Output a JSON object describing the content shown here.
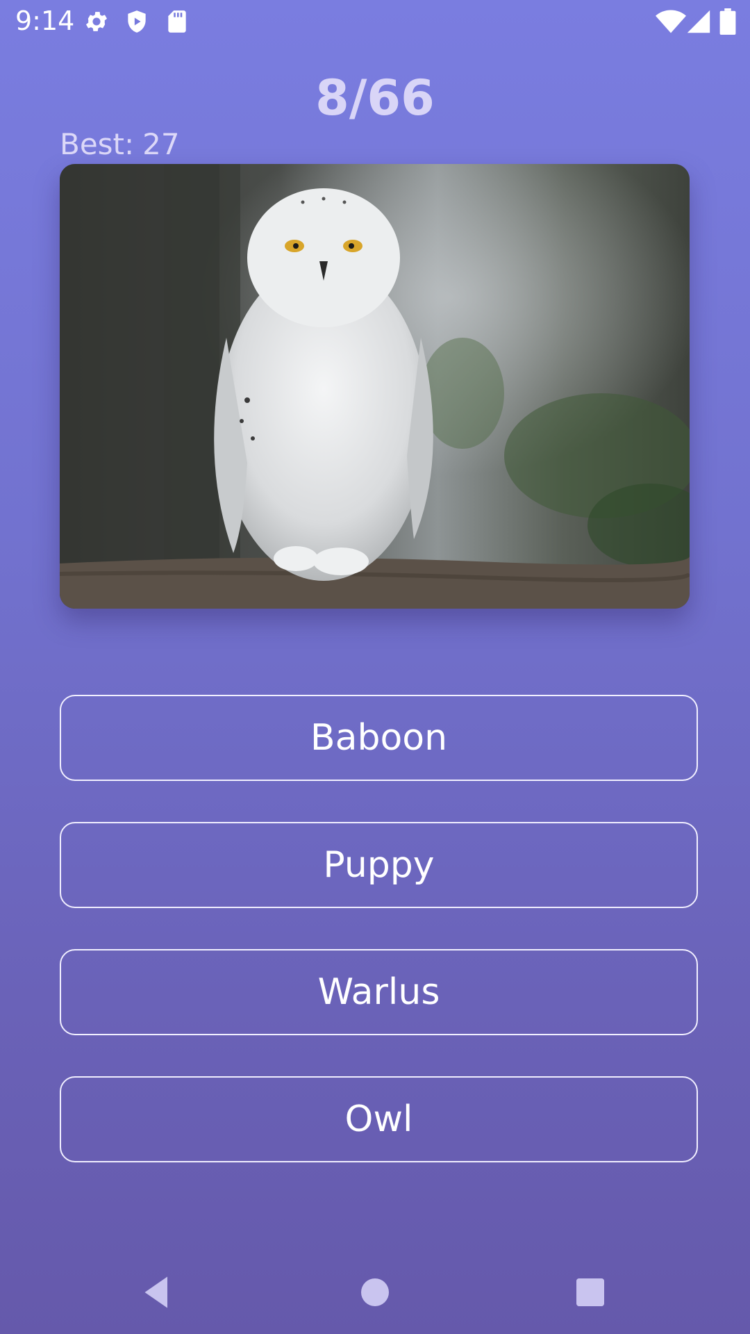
{
  "status_bar": {
    "time": "9:14",
    "left_icons": [
      "gear-icon",
      "shield-play-icon",
      "sd-card-icon"
    ],
    "right_icons": [
      "wifi-icon",
      "signal-icon",
      "battery-icon"
    ]
  },
  "quiz": {
    "progress": "8/66",
    "best_label": "Best:",
    "best_value": "27"
  },
  "photo": {
    "subject": "snowy owl perched on a branch"
  },
  "answers": [
    {
      "label": "Baboon"
    },
    {
      "label": "Puppy"
    },
    {
      "label": "Warlus"
    },
    {
      "label": "Owl"
    }
  ],
  "nav_bar": {
    "icons": [
      "back-icon",
      "home-icon",
      "recents-icon"
    ]
  },
  "colors": {
    "gradient_top": "#7a7de0",
    "gradient_bottom": "#6559ab",
    "score_text": "#d9d5f7",
    "button_border": "#f1efff"
  }
}
